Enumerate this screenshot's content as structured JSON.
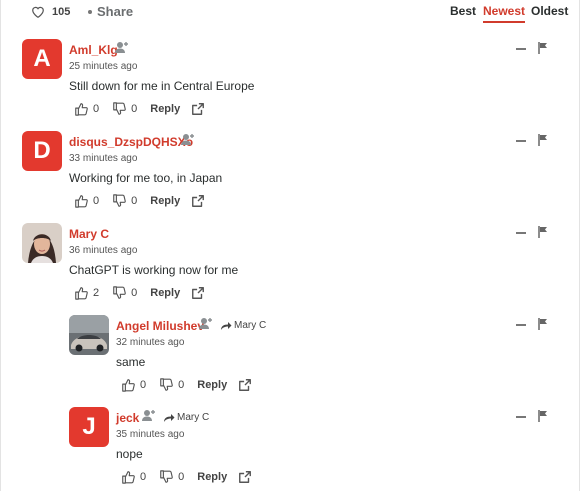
{
  "topbar": {
    "likes": "105",
    "share": "Share",
    "sort_tabs": {
      "best": "Best",
      "newest": "Newest",
      "oldest": "Oldest"
    },
    "active_sort": "Newest"
  },
  "colors": {
    "accent": "#d13b2c",
    "avatar_bg": "#e3392e"
  },
  "reply_label": "Reply",
  "comments": [
    {
      "avatar_letter": "A",
      "author": "Aml_Klg",
      "time": "25 minutes ago",
      "text": "Still down for me in Central Europe",
      "upvotes": "0",
      "downvotes": "0"
    },
    {
      "avatar_letter": "D",
      "author": "disqus_DzspDQHSXo",
      "time": "33 minutes ago",
      "text": "Working for me too, in Japan",
      "upvotes": "0",
      "downvotes": "0"
    },
    {
      "avatar": "photo-woman",
      "author": "Mary C",
      "time": "36 minutes ago",
      "text": "ChatGPT is working now for me",
      "upvotes": "2",
      "downvotes": "0"
    },
    {
      "avatar": "photo-car",
      "author": "Angel Milushev",
      "reply_to": "Mary C",
      "time": "32 minutes ago",
      "text": "same",
      "upvotes": "0",
      "downvotes": "0"
    },
    {
      "avatar_letter": "J",
      "author": "jeck",
      "reply_to": "Mary C",
      "time": "35 minutes ago",
      "text": "nope",
      "upvotes": "0",
      "downvotes": "0"
    }
  ]
}
